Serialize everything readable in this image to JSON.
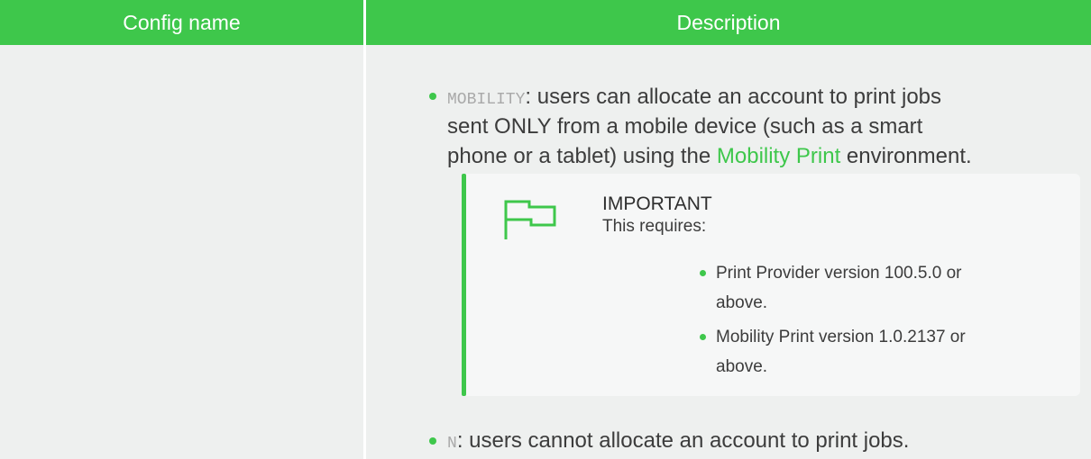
{
  "table": {
    "headers": [
      "Config name",
      "Description"
    ]
  },
  "description": {
    "item1": {
      "code": "MOBILITY",
      "line1_rest": ": users can allocate an account to print jobs",
      "line2": "sent ONLY from a mobile device (such as a smart",
      "line3_pre": "phone or a tablet) using the ",
      "line3_link": "Mobility Print",
      "line3_post": " environment."
    },
    "note": {
      "icon": "flag-icon",
      "title": "IMPORTANT",
      "subtitle": "This requires:",
      "items": [
        {
          "line1": "Print Provider version 100.5.0 or",
          "line2": "above."
        },
        {
          "line1": "Mobility Print version 1.0.2137 or",
          "line2": "above."
        }
      ]
    },
    "item2": {
      "code": "N",
      "rest": ": users cannot allocate an account to print jobs."
    }
  },
  "colors": {
    "accent": "#3ec74b",
    "cell_bg": "#eef0ef",
    "note_bg": "#f6f7f7",
    "code_text": "#a9a9a9"
  }
}
